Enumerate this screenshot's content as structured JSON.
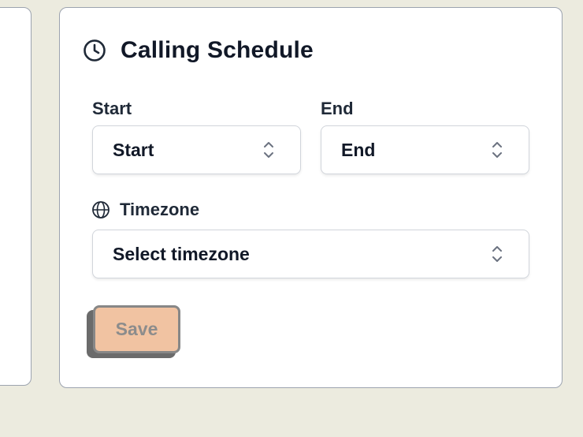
{
  "card": {
    "title": "Calling Schedule",
    "title_icon": "clock-icon"
  },
  "start": {
    "label": "Start",
    "value": "Start"
  },
  "end": {
    "label": "End",
    "value": "End"
  },
  "timezone": {
    "label": "Timezone",
    "label_icon": "globe-icon",
    "value": "Select timezone"
  },
  "save": {
    "label": "Save"
  },
  "colors": {
    "background": "#ecebdf",
    "card": "#ffffff",
    "save_fill": "#f1c3a2",
    "save_text": "#8c8c8c"
  }
}
